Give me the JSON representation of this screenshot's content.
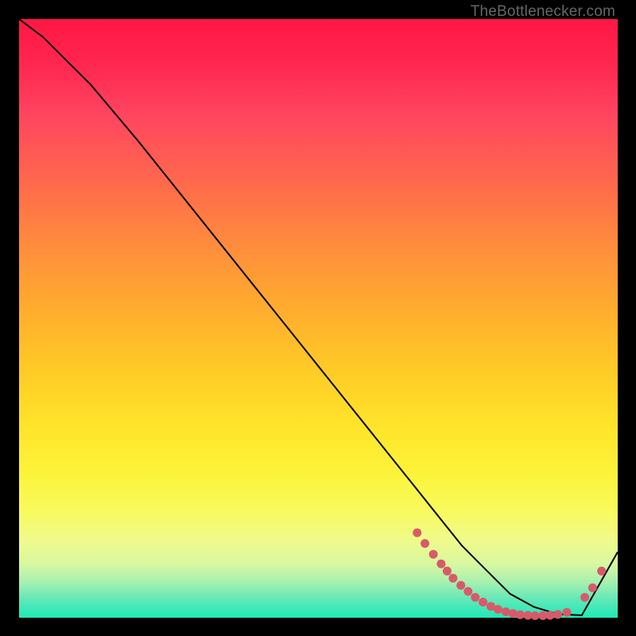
{
  "attribution": "TheBottlenecker.com",
  "chart_data": {
    "type": "line",
    "title": "",
    "xlabel": "",
    "ylabel": "",
    "xlim": [
      0,
      100
    ],
    "ylim": [
      0,
      100
    ],
    "series": [
      {
        "name": "curve",
        "x": [
          0,
          4,
          8,
          12,
          20,
          30,
          40,
          50,
          60,
          66,
          70,
          74,
          78,
          82,
          86,
          90,
          94,
          100
        ],
        "y": [
          100,
          97,
          93,
          89,
          79.5,
          67,
          54.5,
          42,
          29.5,
          22,
          17,
          12,
          8,
          4,
          1.8,
          0.6,
          0.4,
          11
        ]
      }
    ],
    "markers": [
      {
        "x": 66.5,
        "y": 14.2
      },
      {
        "x": 67.8,
        "y": 12.4
      },
      {
        "x": 69.2,
        "y": 10.6
      },
      {
        "x": 70.5,
        "y": 9.0
      },
      {
        "x": 71.5,
        "y": 7.8
      },
      {
        "x": 72.5,
        "y": 6.6
      },
      {
        "x": 73.8,
        "y": 5.4
      },
      {
        "x": 75.0,
        "y": 4.4
      },
      {
        "x": 76.2,
        "y": 3.4
      },
      {
        "x": 77.5,
        "y": 2.6
      },
      {
        "x": 78.8,
        "y": 1.9
      },
      {
        "x": 80.0,
        "y": 1.4
      },
      {
        "x": 81.3,
        "y": 1.0
      },
      {
        "x": 82.5,
        "y": 0.7
      },
      {
        "x": 83.7,
        "y": 0.5
      },
      {
        "x": 85.0,
        "y": 0.4
      },
      {
        "x": 86.2,
        "y": 0.35
      },
      {
        "x": 87.5,
        "y": 0.35
      },
      {
        "x": 88.7,
        "y": 0.4
      },
      {
        "x": 90.0,
        "y": 0.55
      },
      {
        "x": 91.5,
        "y": 0.9
      },
      {
        "x": 94.5,
        "y": 3.4
      },
      {
        "x": 95.8,
        "y": 5.0
      },
      {
        "x": 97.3,
        "y": 7.8
      }
    ],
    "colors": {
      "curve": "#000000",
      "markers": "#d85a6a",
      "gradient_top": "#ff1744",
      "gradient_bottom": "#1de9b6"
    }
  }
}
